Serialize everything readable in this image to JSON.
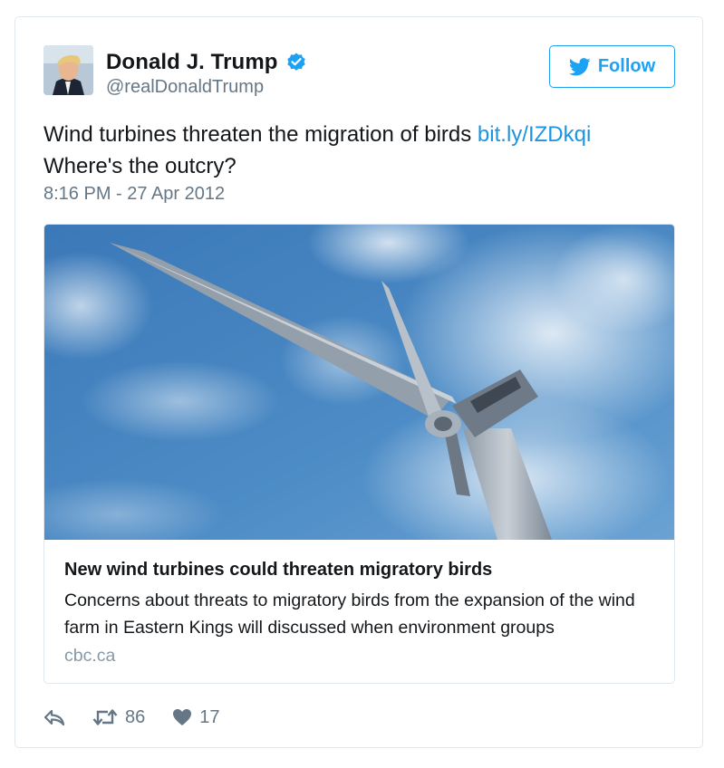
{
  "author": {
    "display_name": "Donald J. Trump",
    "handle": "@realDonaldTrump",
    "verified": true
  },
  "follow_button": {
    "label": "Follow",
    "icon": "twitter-bird-icon"
  },
  "tweet": {
    "text_before_link": "Wind turbines threaten the migration of birds ",
    "link": "bit.ly/IZDkqi",
    "text_after_link": "Where's the outcry?",
    "timestamp": "8:16 PM - 27 Apr 2012"
  },
  "link_card": {
    "title": "New wind turbines could threaten migratory birds",
    "description": "Concerns about threats to migratory birds from the expansion of the wind farm in Eastern Kings will discussed when environment groups",
    "domain": "cbc.ca"
  },
  "actions": {
    "reply_icon": "reply-icon",
    "retweet_icon": "retweet-icon",
    "retweet_count": "86",
    "like_icon": "heart-icon",
    "like_count": "17"
  },
  "colors": {
    "accent": "#1da1f2",
    "link": "#1b95e0",
    "secondary_text": "#657786",
    "border": "#e1e8ed"
  }
}
